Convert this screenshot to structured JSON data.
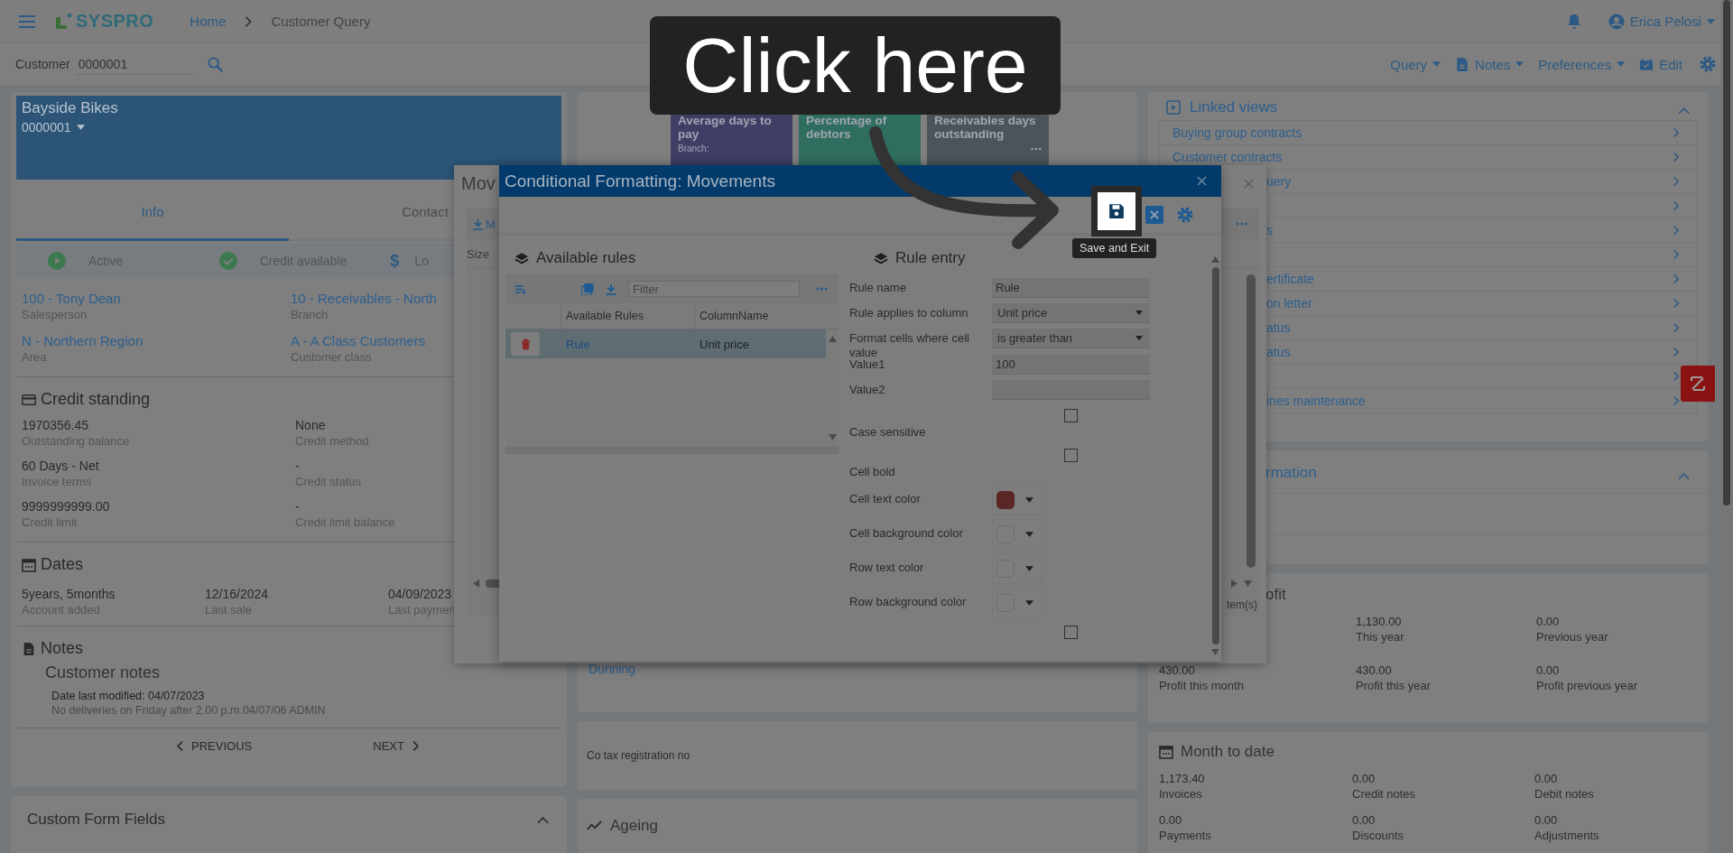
{
  "top_bar": {
    "logo": "SYSPRO",
    "breadcrumb": [
      {
        "label": "Home",
        "kind": "link"
      },
      {
        "label": "Customer Query",
        "kind": "current"
      }
    ],
    "user": "Erica Pelosi"
  },
  "customer_bar": {
    "label": "Customer",
    "value": "0000001",
    "query_menu": "Query",
    "notes_menu": "Notes",
    "preferences_menu": "Preferences",
    "edit_button": "Edit"
  },
  "customer_card": {
    "name": "Bayside Bikes",
    "code": "0000001",
    "tabs": [
      {
        "label": "Info",
        "selected": true
      },
      {
        "label": "Contact",
        "selected": false
      }
    ],
    "statuses": [
      {
        "label": "Active",
        "kind": "play"
      },
      {
        "label": "Credit available",
        "kind": "check"
      },
      {
        "label": "Lo",
        "kind": "symbol",
        "symbol": "$"
      }
    ],
    "info": [
      {
        "value": "100 - Tony Dean",
        "label": "Salesperson"
      },
      {
        "value": "10 - Receivables - North",
        "label": "Branch"
      },
      {
        "value": "N - Northern Region",
        "label": "Area"
      },
      {
        "value": "A - A Class Customers",
        "label": "Customer class"
      }
    ],
    "credit_standing": {
      "title": "Credit standing",
      "fields": [
        {
          "value": "1970356.45",
          "label": "Outstanding balance"
        },
        {
          "value": "None",
          "label": "Credit method"
        },
        {
          "value": "60 Days - Net",
          "label": "Invoice terms"
        },
        {
          "value": "-",
          "label": "Credit status"
        },
        {
          "value": "9999999999.00",
          "label": "Credit limit"
        },
        {
          "value": "-",
          "label": "Credit limit balance"
        }
      ]
    },
    "dates": {
      "title": "Dates",
      "fields": [
        {
          "value": "5years, 5months",
          "label": "Account added"
        },
        {
          "value": "12/16/2024",
          "label": "Last sale"
        },
        {
          "value": "04/09/2023",
          "label": "Last paymen"
        }
      ]
    },
    "notes": {
      "title": "Notes",
      "heading": "Customer notes",
      "modified": "Date last modified: 04/07/2023",
      "text": "No deliveries on Friday after 2.00 p.m.04/07/06 ADMIN",
      "previous": "PREVIOUS",
      "next": "NEXT"
    }
  },
  "custom_form_fields": {
    "title": "Custom Form Fields",
    "expanded": true
  },
  "tiles": [
    {
      "title": "Average days to pay",
      "subtitle": "Branch:",
      "color": "#3f3f66",
      "menu": false
    },
    {
      "title": "Percentage of debtors",
      "color": "#2f6e5f",
      "menu": false
    },
    {
      "title": "Receivables days outstanding",
      "color": "#4b5559",
      "menu": true
    }
  ],
  "dunning": "Dunning",
  "tax_label": "Co tax registration no",
  "ageing": "Ageing",
  "linked_views": {
    "title": "Linked views",
    "expanded": true,
    "items": [
      {
        "label": "Buying group contracts",
        "clipped": false
      },
      {
        "label": "Customer contracts",
        "clipped": false
      },
      {
        "label": "uery",
        "clipped": true
      },
      {
        "clipped": true
      },
      {
        "label": "s",
        "clipped": true
      },
      {
        "clipped": true
      },
      {
        "label": "ertificate",
        "clipped": true
      },
      {
        "label": "on letter",
        "clipped": true
      },
      {
        "label": "atus",
        "clipped": true
      },
      {
        "label": "atus",
        "clipped": true
      },
      {
        "clipped": true
      },
      {
        "label": "ines maintenance",
        "clipped": true
      }
    ]
  },
  "information": {
    "title": "rmation",
    "expanded": true
  },
  "profit": {
    "title": "ofit",
    "rows": [
      [
        {},
        {
          "value": "1,130.00",
          "label": "This year"
        },
        {
          "value": "0.00",
          "label": "Previous year"
        }
      ],
      [
        {
          "value": "430.00",
          "label": "Profit this month"
        },
        {
          "value": "430.00",
          "label": "Profit this year"
        },
        {
          "value": "0.00",
          "label": "Profit previous year"
        }
      ]
    ]
  },
  "month_to_date": {
    "title": "Month to date",
    "fields": [
      {
        "value": "1,173.40",
        "label": "Invoices"
      },
      {
        "value": "0.00",
        "label": "Credit notes"
      },
      {
        "value": "0.00",
        "label": "Debit notes"
      },
      {
        "value": "0.00",
        "label": "Payments"
      },
      {
        "value": "0.00",
        "label": "Discounts"
      },
      {
        "value": "0.00",
        "label": "Adjustments"
      }
    ]
  },
  "back_dialog": {
    "title": "Mov",
    "toolbar_label": "M",
    "column": "Size",
    "footer": "tem(s)"
  },
  "dialog": {
    "title": "Conditional Formatting: Movements",
    "save_tooltip": "Save and Exit",
    "rules": {
      "title": "Available rules",
      "filter_placeholder": "Filter",
      "columns": [
        "Available Rules",
        "ColumnName"
      ],
      "rows": [
        {
          "rule": "Rule",
          "column": "Unit price",
          "selected": true
        }
      ]
    },
    "entry": {
      "title": "Rule entry",
      "fields": [
        {
          "label": "Rule name",
          "kind": "text",
          "value": "Rule"
        },
        {
          "label": "Rule applies to column",
          "kind": "select",
          "value": "Unit price"
        },
        {
          "label": "Format cells where cell value",
          "kind": "select",
          "value": "is greater than"
        },
        {
          "label": "Value1",
          "kind": "text",
          "value": "100"
        },
        {
          "label": "Value2",
          "kind": "text"
        },
        {
          "label": "Case sensitive",
          "kind": "checkbox",
          "checked": false
        },
        {
          "label": "Cell bold",
          "kind": "checkbox",
          "checked": false
        },
        {
          "label": "Cell text color",
          "kind": "color",
          "color": "#5a2626"
        },
        {
          "label": "Cell background color",
          "kind": "color"
        },
        {
          "label": "Row text color",
          "kind": "color"
        },
        {
          "label": "Row background color",
          "kind": "color"
        },
        {
          "kind": "checkbox",
          "checked": false
        }
      ]
    }
  },
  "callout": {
    "text": "Click here"
  }
}
